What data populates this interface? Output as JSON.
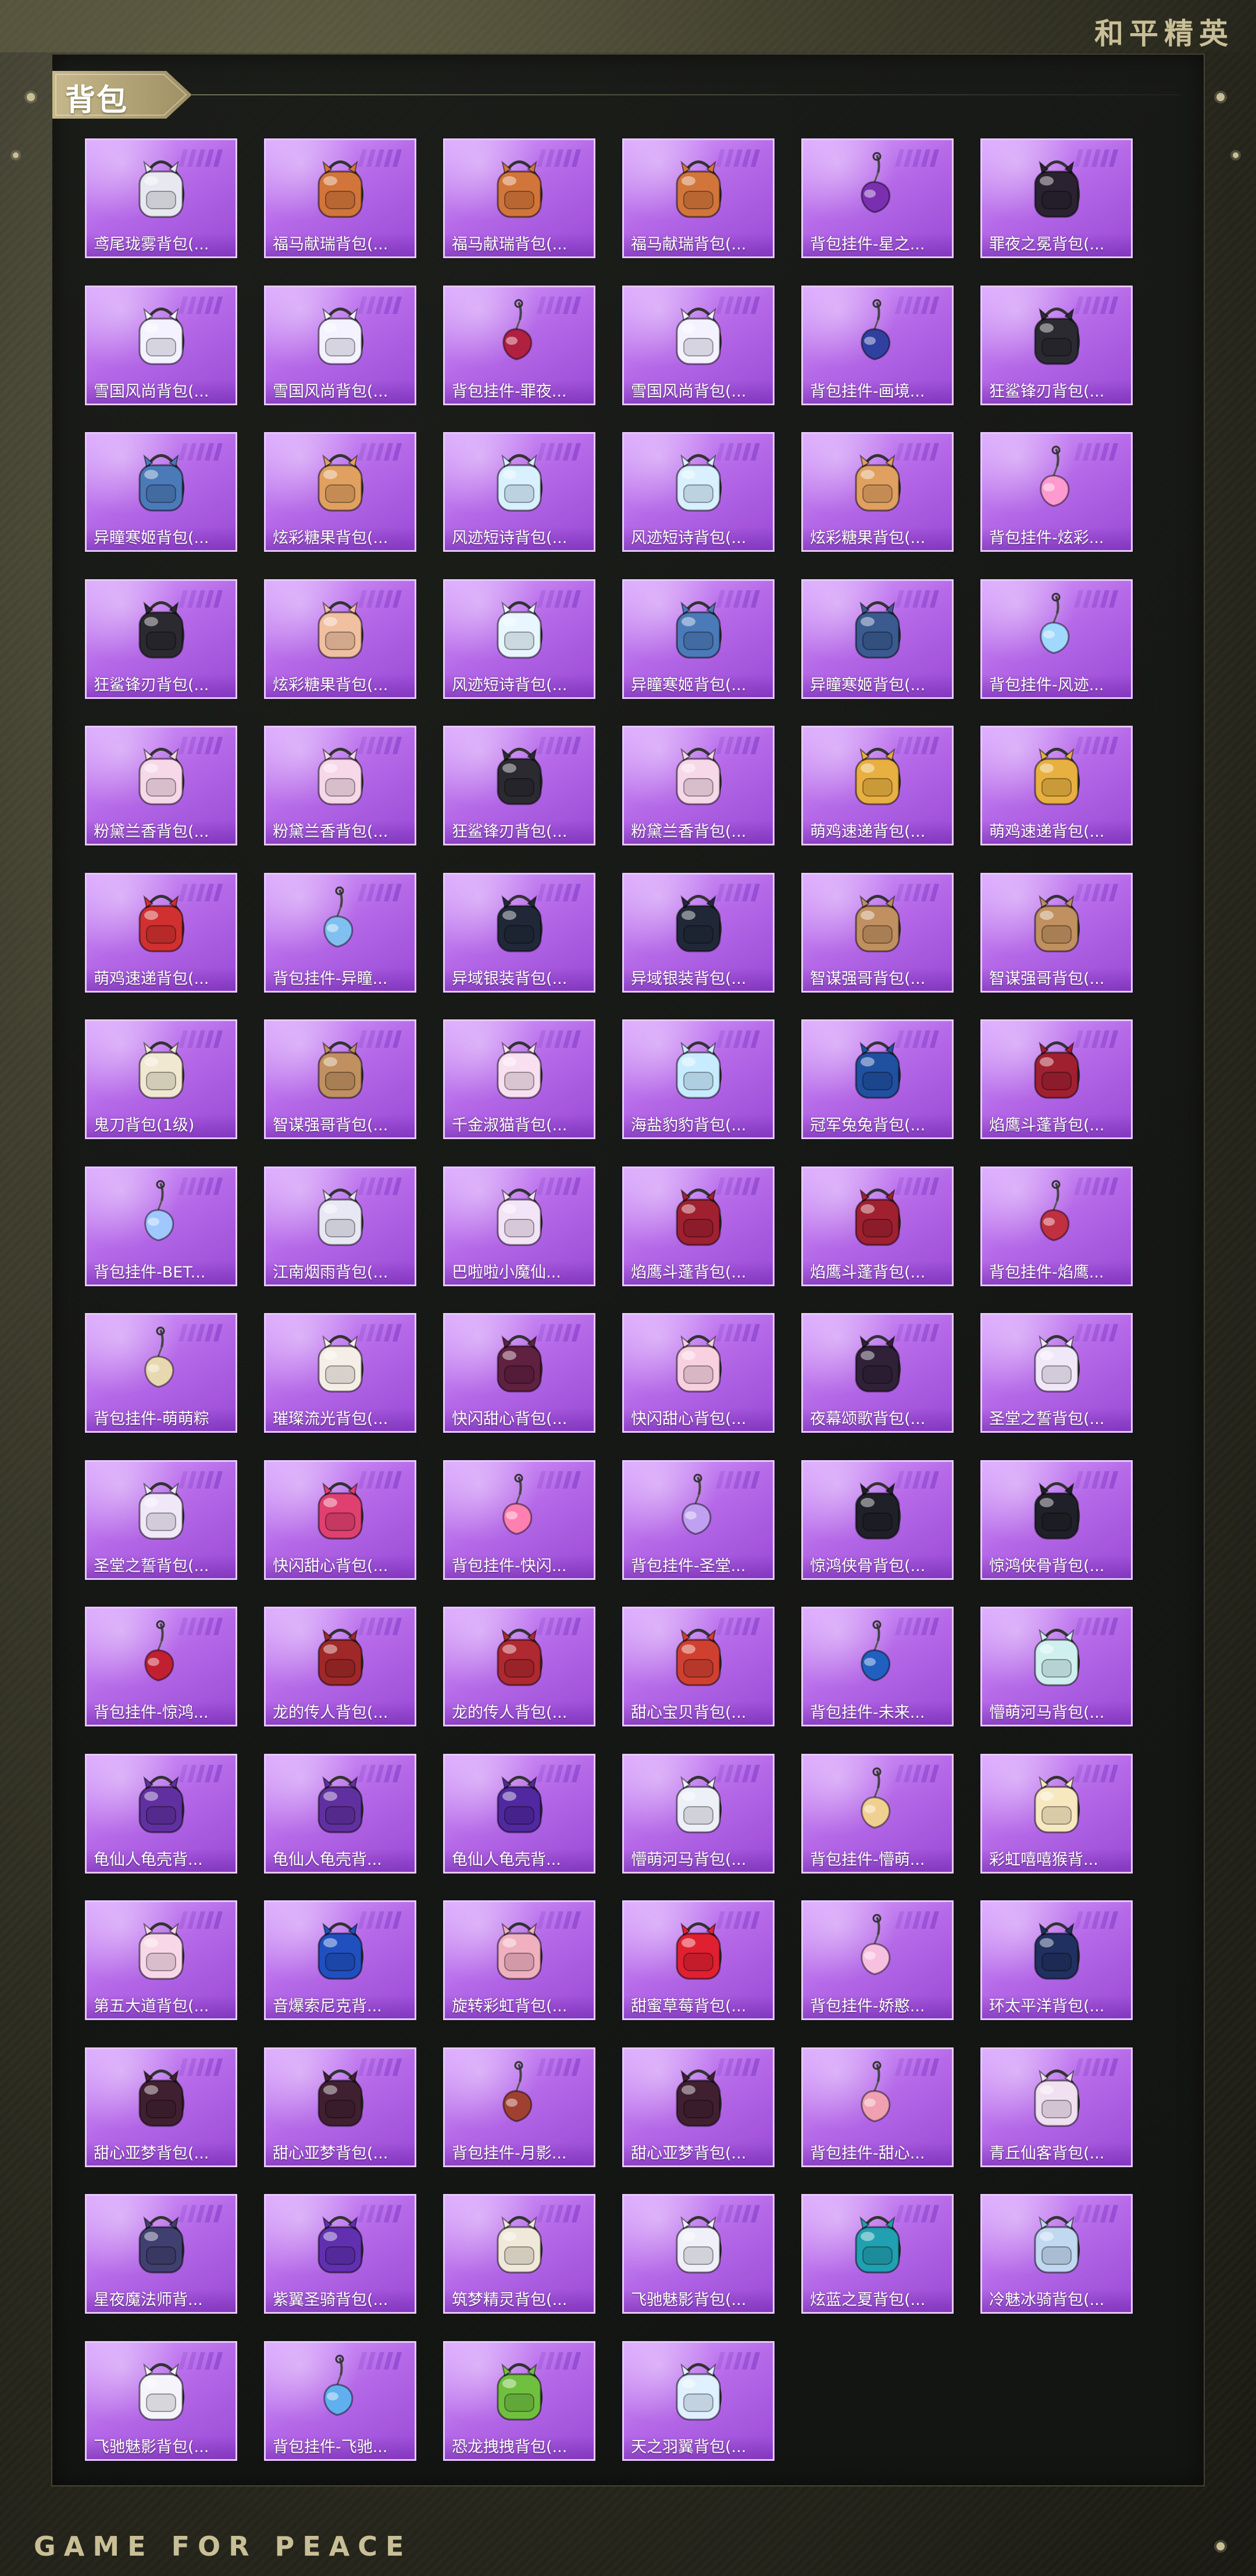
{
  "brand": "和平精英",
  "footer_brand": "GAME FOR PEACE",
  "section_title": "背包",
  "accent_colors": {
    "card_border": "#e7c8ff",
    "card_fill_light": "#dba6ff",
    "card_fill_dark": "#9a4ad6",
    "brand_gold": "#c9bf97"
  },
  "items": [
    {
      "name": "鸢尾珑雾背包(...",
      "icon": "backpack-icon",
      "tint": "#e8e8f0"
    },
    {
      "name": "福马献瑞背包(...",
      "icon": "backpack-icon",
      "tint": "#d2753a"
    },
    {
      "name": "福马献瑞背包(...",
      "icon": "backpack-icon",
      "tint": "#d2753a"
    },
    {
      "name": "福马献瑞背包(...",
      "icon": "backpack-icon",
      "tint": "#d2753a"
    },
    {
      "name": "背包挂件-星之...",
      "icon": "pendant-icon",
      "tint": "#7a2fb0"
    },
    {
      "name": "罪夜之冕背包(...",
      "icon": "backpack-icon",
      "tint": "#2a2230"
    },
    {
      "name": "雪国风尚背包(...",
      "icon": "backpack-icon",
      "tint": "#f4f2ff"
    },
    {
      "name": "雪国风尚背包(...",
      "icon": "backpack-icon",
      "tint": "#f4f2ff"
    },
    {
      "name": "背包挂件-罪夜...",
      "icon": "pendant-icon",
      "tint": "#b02040"
    },
    {
      "name": "雪国风尚背包(...",
      "icon": "backpack-icon",
      "tint": "#f4f2ff"
    },
    {
      "name": "背包挂件-画境...",
      "icon": "pendant-icon",
      "tint": "#3040a0"
    },
    {
      "name": "狂鲨锋刃背包(...",
      "icon": "backpack-icon",
      "tint": "#2a2a30"
    },
    {
      "name": "异瞳寒姬背包(...",
      "icon": "backpack-icon",
      "tint": "#4a7ab8"
    },
    {
      "name": "炫彩糖果背包(...",
      "icon": "backpack-icon",
      "tint": "#e0a060"
    },
    {
      "name": "风迹短诗背包(...",
      "icon": "backpack-icon",
      "tint": "#d8f0ff"
    },
    {
      "name": "风迹短诗背包(...",
      "icon": "backpack-icon",
      "tint": "#d8f0ff"
    },
    {
      "name": "炫彩糖果背包(...",
      "icon": "backpack-icon",
      "tint": "#e0a060"
    },
    {
      "name": "背包挂件-炫彩...",
      "icon": "pendant-icon",
      "tint": "#ff9ad0"
    },
    {
      "name": "狂鲨锋刃背包(...",
      "icon": "backpack-icon",
      "tint": "#2a2a30"
    },
    {
      "name": "炫彩糖果背包(...",
      "icon": "backpack-icon",
      "tint": "#f0c0a0"
    },
    {
      "name": "风迹短诗背包(...",
      "icon": "backpack-icon",
      "tint": "#e8f6ff"
    },
    {
      "name": "异瞳寒姬背包(...",
      "icon": "backpack-icon",
      "tint": "#4a7ab8"
    },
    {
      "name": "异瞳寒姬背包(...",
      "icon": "backpack-icon",
      "tint": "#3a5a90"
    },
    {
      "name": "背包挂件-风迹...",
      "icon": "pendant-icon",
      "tint": "#a0d8ff"
    },
    {
      "name": "粉黛兰香背包(...",
      "icon": "backpack-icon",
      "tint": "#f6d8e8"
    },
    {
      "name": "粉黛兰香背包(...",
      "icon": "backpack-icon",
      "tint": "#f6d8e8"
    },
    {
      "name": "狂鲨锋刃背包(...",
      "icon": "backpack-icon",
      "tint": "#2a2a30"
    },
    {
      "name": "粉黛兰香背包(...",
      "icon": "backpack-icon",
      "tint": "#f6d8e8"
    },
    {
      "name": "萌鸡速递背包(...",
      "icon": "backpack-icon",
      "tint": "#e8b040"
    },
    {
      "name": "萌鸡速递背包(...",
      "icon": "backpack-icon",
      "tint": "#e8b040"
    },
    {
      "name": "萌鸡速递背包(...",
      "icon": "backpack-icon",
      "tint": "#d03030"
    },
    {
      "name": "背包挂件-异瞳...",
      "icon": "pendant-icon",
      "tint": "#80c0f0"
    },
    {
      "name": "异域银装背包(...",
      "icon": "backpack-icon",
      "tint": "#202838"
    },
    {
      "name": "异域银装背包(...",
      "icon": "backpack-icon",
      "tint": "#202838"
    },
    {
      "name": "智谋强哥背包(...",
      "icon": "backpack-icon",
      "tint": "#c09060"
    },
    {
      "name": "智谋强哥背包(...",
      "icon": "backpack-icon",
      "tint": "#c09060"
    },
    {
      "name": "鬼刀背包(1级)",
      "icon": "backpack-icon",
      "tint": "#f0e8d0"
    },
    {
      "name": "智谋强哥背包(...",
      "icon": "backpack-icon",
      "tint": "#c09060"
    },
    {
      "name": "千金淑猫背包(...",
      "icon": "backpack-icon",
      "tint": "#f8e0f0"
    },
    {
      "name": "海盐豹豹背包(...",
      "icon": "backpack-icon",
      "tint": "#c8ecff"
    },
    {
      "name": "冠军兔兔背包(...",
      "icon": "backpack-icon",
      "tint": "#2050a0"
    },
    {
      "name": "焰鹰斗蓬背包(...",
      "icon": "backpack-icon",
      "tint": "#a02030"
    },
    {
      "name": "背包挂件-BET...",
      "icon": "pendant-icon",
      "tint": "#a0c8ff"
    },
    {
      "name": "江南烟雨背包(...",
      "icon": "backpack-icon",
      "tint": "#e8e8f4"
    },
    {
      "name": "巴啦啦小魔仙...",
      "icon": "backpack-icon",
      "tint": "#f4e4f8"
    },
    {
      "name": "焰鹰斗蓬背包(...",
      "icon": "backpack-icon",
      "tint": "#a02030"
    },
    {
      "name": "焰鹰斗蓬背包(...",
      "icon": "backpack-icon",
      "tint": "#a02030"
    },
    {
      "name": "背包挂件-焰鹰...",
      "icon": "pendant-icon",
      "tint": "#c03040"
    },
    {
      "name": "背包挂件-萌萌粽",
      "icon": "pendant-icon",
      "tint": "#e8d8b0"
    },
    {
      "name": "璀璨流光背包(...",
      "icon": "backpack-icon",
      "tint": "#f4eee6"
    },
    {
      "name": "快闪甜心背包(...",
      "icon": "backpack-icon",
      "tint": "#602040"
    },
    {
      "name": "快闪甜心背包(...",
      "icon": "backpack-icon",
      "tint": "#f8d0e0"
    },
    {
      "name": "夜幕颂歌背包(...",
      "icon": "backpack-icon",
      "tint": "#302038"
    },
    {
      "name": "圣堂之誓背包(...",
      "icon": "backpack-icon",
      "tint": "#f0e8f8"
    },
    {
      "name": "圣堂之誓背包(...",
      "icon": "backpack-icon",
      "tint": "#f0e8f8"
    },
    {
      "name": "快闪甜心背包(...",
      "icon": "backpack-icon",
      "tint": "#e04070"
    },
    {
      "name": "背包挂件-快闪...",
      "icon": "pendant-icon",
      "tint": "#ff80b0"
    },
    {
      "name": "背包挂件-圣堂...",
      "icon": "pendant-icon",
      "tint": "#c0a0f0"
    },
    {
      "name": "惊鸿侠骨背包(...",
      "icon": "backpack-icon",
      "tint": "#202028"
    },
    {
      "name": "惊鸿侠骨背包(...",
      "icon": "backpack-icon",
      "tint": "#202028"
    },
    {
      "name": "背包挂件-惊鸿...",
      "icon": "pendant-icon",
      "tint": "#c02030"
    },
    {
      "name": "龙的传人背包(...",
      "icon": "backpack-icon",
      "tint": "#a02828"
    },
    {
      "name": "龙的传人背包(...",
      "icon": "backpack-icon",
      "tint": "#b02830"
    },
    {
      "name": "甜心宝贝背包(...",
      "icon": "backpack-icon",
      "tint": "#d04030"
    },
    {
      "name": "背包挂件-未来...",
      "icon": "pendant-icon",
      "tint": "#2060c0"
    },
    {
      "name": "懵萌河马背包(...",
      "icon": "backpack-icon",
      "tint": "#d0f0f0"
    },
    {
      "name": "龟仙人龟壳背...",
      "icon": "backpack-icon",
      "tint": "#6030a0"
    },
    {
      "name": "龟仙人龟壳背...",
      "icon": "backpack-icon",
      "tint": "#6030a0"
    },
    {
      "name": "龟仙人龟壳背...",
      "icon": "backpack-icon",
      "tint": "#5028a0"
    },
    {
      "name": "懵萌河马背包(...",
      "icon": "backpack-icon",
      "tint": "#eef0f8"
    },
    {
      "name": "背包挂件-懵萌...",
      "icon": "pendant-icon",
      "tint": "#f0d090"
    },
    {
      "name": "彩虹嘻嘻猴背...",
      "icon": "backpack-icon",
      "tint": "#f8e8c0"
    },
    {
      "name": "第五大道背包(...",
      "icon": "backpack-icon",
      "tint": "#f8d8e8"
    },
    {
      "name": "音爆索尼克背...",
      "icon": "backpack-icon",
      "tint": "#2050c0"
    },
    {
      "name": "旋转彩虹背包(...",
      "icon": "backpack-icon",
      "tint": "#f0b0c0"
    },
    {
      "name": "甜蜜草莓背包(...",
      "icon": "backpack-icon",
      "tint": "#e02030"
    },
    {
      "name": "背包挂件-娇憨...",
      "icon": "pendant-icon",
      "tint": "#f8c0e0"
    },
    {
      "name": "环太平洋背包(...",
      "icon": "backpack-icon",
      "tint": "#203060"
    },
    {
      "name": "甜心亚梦背包(...",
      "icon": "backpack-icon",
      "tint": "#402030"
    },
    {
      "name": "甜心亚梦背包(...",
      "icon": "backpack-icon",
      "tint": "#402030"
    },
    {
      "name": "背包挂件-月影...",
      "icon": "pendant-icon",
      "tint": "#a04030"
    },
    {
      "name": "甜心亚梦背包(...",
      "icon": "backpack-icon",
      "tint": "#402030"
    },
    {
      "name": "背包挂件-甜心...",
      "icon": "pendant-icon",
      "tint": "#f0a0b0"
    },
    {
      "name": "青丘仙客背包(...",
      "icon": "backpack-icon",
      "tint": "#f0e0f0"
    },
    {
      "name": "星夜魔法师背...",
      "icon": "backpack-icon",
      "tint": "#404070"
    },
    {
      "name": "紫翼圣骑背包(...",
      "icon": "backpack-icon",
      "tint": "#6030b0"
    },
    {
      "name": "筑梦精灵背包(...",
      "icon": "backpack-icon",
      "tint": "#f0e8d8"
    },
    {
      "name": "飞驰魅影背包(...",
      "icon": "backpack-icon",
      "tint": "#f0f0f8"
    },
    {
      "name": "炫蓝之夏背包(...",
      "icon": "backpack-icon",
      "tint": "#20a0b0"
    },
    {
      "name": "冷魅冰骑背包(...",
      "icon": "backpack-icon",
      "tint": "#c0d8f0"
    },
    {
      "name": "飞驰魅影背包(...",
      "icon": "backpack-icon",
      "tint": "#f4f4fa"
    },
    {
      "name": "背包挂件-飞驰...",
      "icon": "pendant-icon",
      "tint": "#60b0f0"
    },
    {
      "name": "恐龙拽拽背包(...",
      "icon": "backpack-icon",
      "tint": "#70c040"
    },
    {
      "name": "天之羽翼背包(...",
      "icon": "backpack-icon",
      "tint": "#dff0ff"
    }
  ]
}
